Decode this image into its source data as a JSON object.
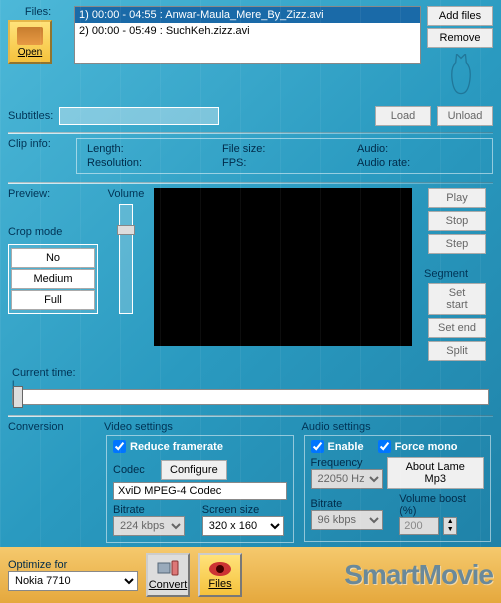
{
  "files": {
    "label": "Files:",
    "open": "Open",
    "add": "Add files",
    "remove": "Remove",
    "list": [
      "1) 00:00 - 04:55 : Anwar-Maula_Mere_By_Zizz.avi",
      "2) 00:00 - 05:49 : SuchKeh.zizz.avi"
    ]
  },
  "subtitles": {
    "label": "Subtitles:",
    "load": "Load",
    "unload": "Unload"
  },
  "clipinfo": {
    "label": "Clip info:",
    "length": "Length:",
    "filesize": "File size:",
    "audio": "Audio:",
    "resolution": "Resolution:",
    "fps": "FPS:",
    "audiorate": "Audio rate:"
  },
  "preview": {
    "label": "Preview:",
    "volume": "Volume",
    "cropmode": "Crop mode",
    "crop": [
      "No",
      "Medium",
      "Full"
    ],
    "play": "Play",
    "stop": "Stop",
    "step": "Step",
    "segment": "Segment",
    "setstart": "Set start",
    "setend": "Set end",
    "split": "Split"
  },
  "timeline": {
    "label": "Current time:"
  },
  "conversion": {
    "label": "Conversion",
    "video": {
      "label": "Video settings",
      "reduce": "Reduce framerate",
      "codec": "Codec",
      "configure": "Configure",
      "codecval": "XviD MPEG-4 Codec",
      "bitrate": "Bitrate",
      "bitrateval": "224 kbps",
      "screensize": "Screen size",
      "screenval": "320 x 160"
    },
    "audio": {
      "label": "Audio settings",
      "enable": "Enable",
      "forcemono": "Force mono",
      "aboutlame": "About Lame Mp3",
      "frequency": "Frequency",
      "freqval": "22050 Hz",
      "bitrate": "Bitrate",
      "bitrateval": "96 kbps",
      "volboost": "Volume boost (%)",
      "volboostval": "200"
    }
  },
  "bottom": {
    "optimize": "Optimize for",
    "device": "Nokia 7710",
    "convert": "Convert",
    "files": "Files",
    "brand": "SmartMovie"
  }
}
